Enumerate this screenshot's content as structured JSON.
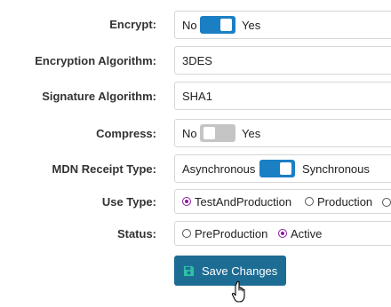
{
  "fields": {
    "encrypt": {
      "label": "Encrypt:",
      "off_text": "No",
      "on_text": "Yes",
      "value": true
    },
    "encryption_algorithm": {
      "label": "Encryption Algorithm:",
      "value": "3DES"
    },
    "signature_algorithm": {
      "label": "Signature Algorithm:",
      "value": "SHA1"
    },
    "compress": {
      "label": "Compress:",
      "off_text": "No",
      "on_text": "Yes",
      "value": false
    },
    "mdn_receipt_type": {
      "label": "MDN Receipt Type:",
      "off_text": "Asynchronous",
      "on_text": "Synchronous",
      "value": true
    },
    "use_type": {
      "label": "Use Type:",
      "options": [
        "TestAndProduction",
        "Production"
      ],
      "selected": "TestAndProduction"
    },
    "status": {
      "label": "Status:",
      "options": [
        "PreProduction",
        "Active"
      ],
      "selected": "Active"
    }
  },
  "save_button": {
    "label": "Save Changes",
    "icon": "floppy-disk-icon"
  },
  "colors": {
    "accent": "#1b7fc4",
    "button": "#1c6c94",
    "radio_selected": "#8a1a9b",
    "toggle_off": "#c5c5c5"
  }
}
